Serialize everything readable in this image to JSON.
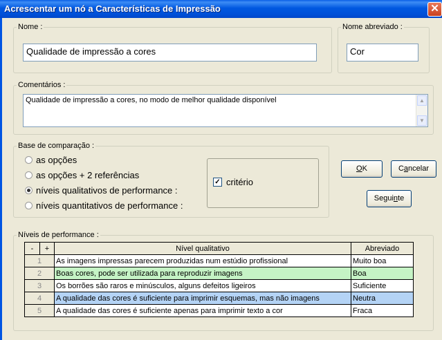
{
  "window": {
    "title": "Acrescentar um nó a Características de Impressão",
    "close_glyph": "✕"
  },
  "nome": {
    "legend": "Nome :",
    "value": "Qualidade de impressão a cores"
  },
  "nome_abreviado": {
    "legend": "Nome abreviado :",
    "value": "Cor"
  },
  "comentarios": {
    "legend": "Comentários :",
    "value": "Qualidade de impressão a cores, no modo de melhor qualidade disponível"
  },
  "base": {
    "legend": "Base de comparação :",
    "options": [
      {
        "label": "as opções",
        "selected": false
      },
      {
        "label": "as opções + 2 referências",
        "selected": false
      },
      {
        "label": "níveis qualitativos de performance :",
        "selected": true
      },
      {
        "label": "níveis quantitativos de performance :",
        "selected": false
      }
    ],
    "criterio_label": "critério",
    "criterio_checked": true,
    "check_glyph": "✓"
  },
  "buttons": {
    "ok_u": "O",
    "ok_rest": "K",
    "cancel_first": "C",
    "cancel_u": "a",
    "cancel_rest": "ncelar",
    "next_first": "Segui",
    "next_u": "n",
    "next_rest": "te"
  },
  "niveis": {
    "legend": "Níveis de performance :",
    "minus": "-",
    "plus": "+",
    "col_nivel": "Nível qualitativo",
    "col_abrev": "Abreviado",
    "rows": [
      {
        "num": "1",
        "text": "As imagens impressas parecem produzidas num estúdio profissional",
        "abrev": "Muito boa",
        "color": "#ffffff"
      },
      {
        "num": "2",
        "text": "Boas cores, pode ser utilizada para reproduzir imagens",
        "abrev": "Boa",
        "color": "#c5f3c5"
      },
      {
        "num": "3",
        "text": "Os borrões são raros e minúsculos, alguns defeitos ligeiros",
        "abrev": "Suficiente",
        "color": "#ffffff"
      },
      {
        "num": "4",
        "text": "A qualidade das cores é suficiente para imprimir esquemas, mas não imagens",
        "abrev": "Neutra",
        "color": "#b4d3f5"
      },
      {
        "num": "5",
        "text": "A qualidade das cores é suficiente apenas para imprimir texto a cor",
        "abrev": "Fraca",
        "color": "#ffffff"
      }
    ]
  }
}
